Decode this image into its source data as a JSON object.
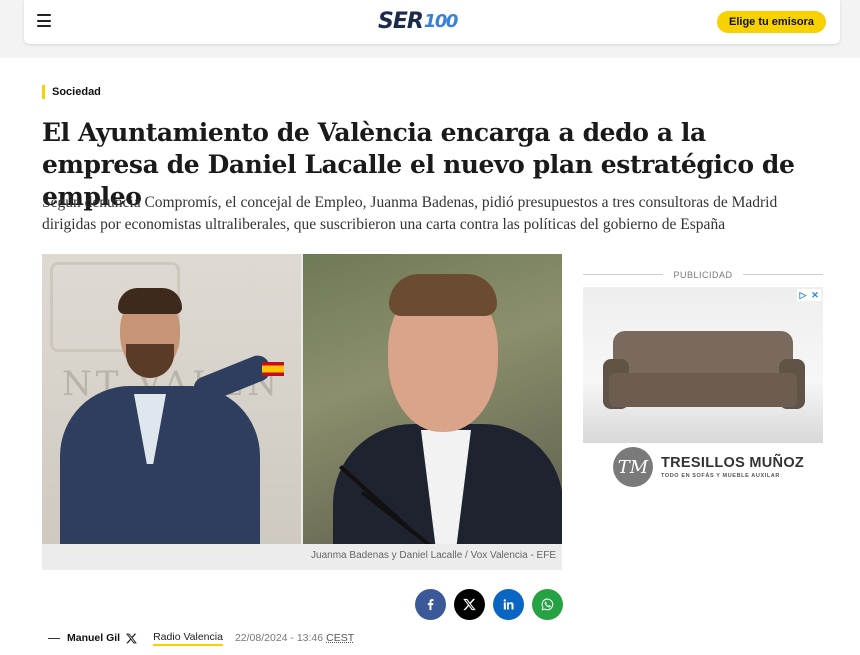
{
  "header": {
    "menu_icon": "hamburger-icon",
    "logo": {
      "brand": "SER",
      "suffix": "100"
    },
    "cta_label": "Elige tu emisora",
    "cta_color": "#f7d200"
  },
  "article": {
    "section": "Sociedad",
    "headline": "El Ayuntamiento de València encarga a dedo a la empresa de Daniel Lacalle el nuevo plan estratégico de empleo",
    "subheadline": "Según denuncia Compromís, el concejal de Empleo, Juanma Badenas, pidió presupuestos a tres consultoras de Madrid dirigidas por economistas ultraliberales, que suscribieron una carta contra las políticas del gobierno de España",
    "photo": {
      "wall_text": "NT VALEN",
      "caption": "Juanma Badenas y Daniel Lacalle / Vox Valencia - EFE"
    }
  },
  "advertising": {
    "label": "PUBLICIDAD",
    "brand_mark": "TM",
    "brand_name": "TRESILLOS MUÑOZ",
    "brand_tagline": "TODO EN SOFÁS Y MUEBLE AUXILAR"
  },
  "share": [
    {
      "network": "facebook",
      "icon": "facebook-icon",
      "color": "#3b5998"
    },
    {
      "network": "x",
      "icon": "x-icon",
      "color": "#000000"
    },
    {
      "network": "linkedin",
      "icon": "linkedin-icon",
      "color": "#0a66c2"
    },
    {
      "network": "whatsapp",
      "icon": "whatsapp-icon",
      "color": "#25a244"
    }
  ],
  "byline": {
    "author": "Manuel Gil",
    "station": "Radio Valencia",
    "date": "22/08/2024 - 13:46",
    "timezone": "CEST"
  }
}
